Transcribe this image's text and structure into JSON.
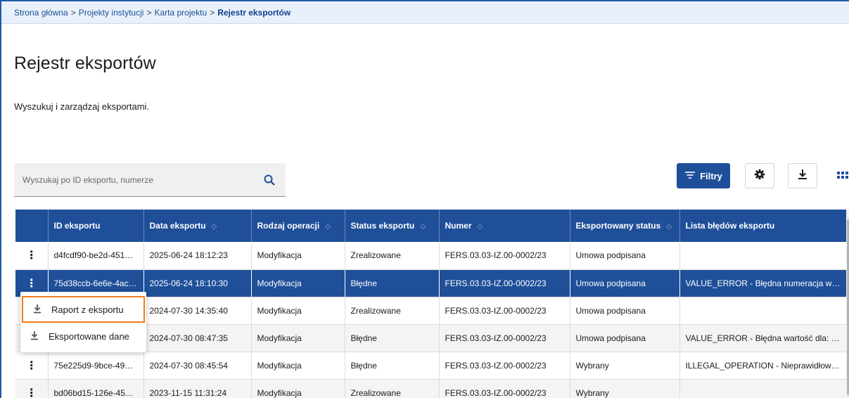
{
  "breadcrumb": {
    "items": [
      "Strona główna",
      "Projekty instytucji",
      "Karta projektu"
    ],
    "current": "Rejestr eksportów",
    "separator": ">"
  },
  "page": {
    "title": "Rejestr eksportów",
    "description": "Wyszukuj i zarządzaj eksportami."
  },
  "search": {
    "placeholder": "Wyszukaj po ID eksportu, numerze",
    "value": ""
  },
  "toolbar": {
    "filters_label": "Filtry",
    "icons": [
      "filter-icon",
      "gear-icon",
      "download-icon",
      "grid-view-icon"
    ]
  },
  "table": {
    "columns": [
      {
        "label": "",
        "sortable": false
      },
      {
        "label": "ID eksportu",
        "sortable": false
      },
      {
        "label": "Data eksportu",
        "sortable": true
      },
      {
        "label": "Rodzaj operacji",
        "sortable": true
      },
      {
        "label": "Status eksportu",
        "sortable": true
      },
      {
        "label": "Numer",
        "sortable": true
      },
      {
        "label": "Eksportowany status",
        "sortable": true
      },
      {
        "label": "Lista błędów eksportu",
        "sortable": false
      }
    ],
    "rows": [
      [
        "d4fcdf90-be2d-451…",
        "2025-06-24 18:12:23",
        "Modyfikacja",
        "Zrealizowane",
        "FERS.03.03-IZ.00-0002/23",
        "Umowa podpisana",
        ""
      ],
      [
        "75d38ccb-6e6e-4ac…",
        "2025-06-24 18:10:30",
        "Modyfikacja",
        "Błędne",
        "FERS.03.03-IZ.00-0002/23",
        "Umowa podpisana",
        "VALUE_ERROR - Błędna numeracja w…"
      ],
      [
        "",
        "2024-07-30 14:35:40",
        "Modyfikacja",
        "Zrealizowane",
        "FERS.03.03-IZ.00-0002/23",
        "Umowa podpisana",
        ""
      ],
      [
        "",
        "2024-07-30 08:47:35",
        "Modyfikacja",
        "Błędne",
        "FERS.03.03-IZ.00-0002/23",
        "Umowa podpisana",
        "VALUE_ERROR - Błędna wartość dla: …"
      ],
      [
        "75e225d9-9bce-49a…",
        "2024-07-30 08:45:54",
        "Modyfikacja",
        "Błędne",
        "FERS.03.03-IZ.00-0002/23",
        "Wybrany",
        "ILLEGAL_OPERATION - Nieprawidłow…"
      ],
      [
        "bd06bd15-126e-45…",
        "2023-11-15 11:31:24",
        "Modyfikacja",
        "Zrealizowane",
        "FERS.03.03-IZ.00-0002/23",
        "Wybrany",
        ""
      ]
    ],
    "selected_row": 1,
    "sort_glyph": "◇"
  },
  "context_menu": {
    "items": [
      {
        "label": "Raport z eksportu",
        "icon": "download-icon",
        "focused": true
      },
      {
        "label": "Eksportowane dane",
        "icon": "download-icon",
        "focused": false
      }
    ]
  },
  "colors": {
    "primary": "#1f4f99",
    "breadcrumb_bg": "#e8f1fb",
    "focus_outline": "#f07d1c"
  }
}
